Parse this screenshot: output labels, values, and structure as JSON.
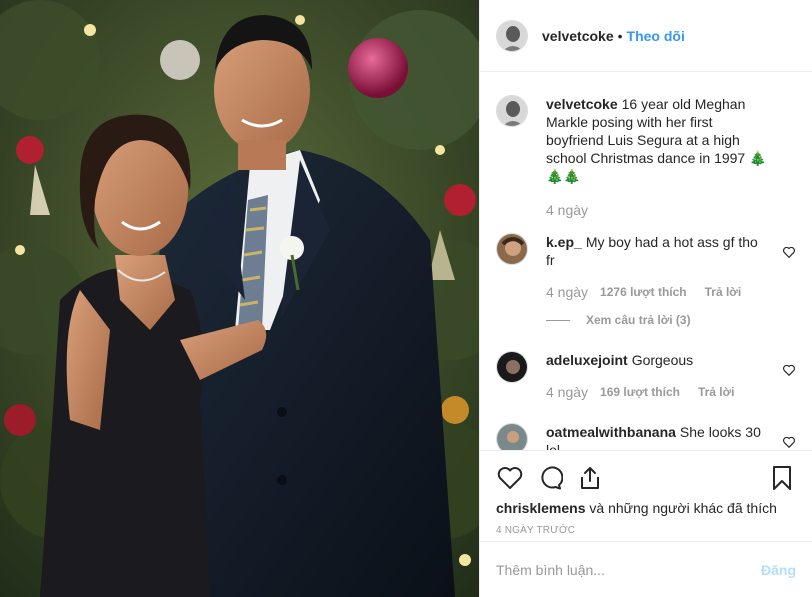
{
  "post": {
    "username": "velvetcoke",
    "separator": "•",
    "follow_label": "Theo dõi",
    "caption": "16 year old Meghan Markle posing with her first boyfriend Luis Segura at a high school Christmas dance in 1997 🎄🎄🎄",
    "caption_age": "4 ngày"
  },
  "comments": [
    {
      "user": "k.ep_",
      "text": "My boy had a hot ass gf tho fr",
      "age": "4 ngày",
      "likes": "1276 lượt thích",
      "reply": "Trả lời",
      "view_replies": "Xem câu trả lời (3)"
    },
    {
      "user": "adeluxejoint",
      "text": "Gorgeous",
      "age": "4 ngày",
      "likes": "169 lượt thích",
      "reply": "Trả lời"
    },
    {
      "user": "oatmealwithbanana",
      "text": "She looks 30 lol"
    }
  ],
  "actions": {
    "like_icon": "heart-icon",
    "comment_icon": "comment-icon",
    "share_icon": "share-icon",
    "save_icon": "bookmark-icon"
  },
  "likes_line": {
    "user": "chrisklemens",
    "rest": "và những người khác đã thích"
  },
  "post_age": "4 NGÀY TRƯỚC",
  "add_comment": {
    "placeholder": "Thêm bình luận...",
    "post_label": "Đăng"
  },
  "colors": {
    "link": "#3897f0",
    "muted": "#999999",
    "post_disabled": "#b2dffc",
    "border": "#efefef"
  }
}
